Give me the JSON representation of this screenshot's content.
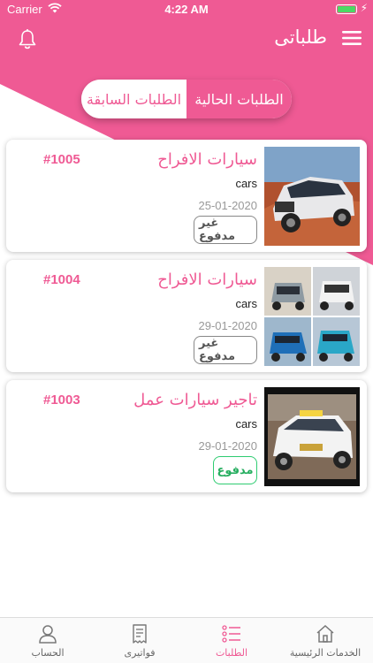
{
  "status_bar": {
    "carrier": "Carrier",
    "time": "4:22 AM"
  },
  "nav": {
    "title": "طلباتى"
  },
  "segment": {
    "past_label": "الطلبات السابقة",
    "current_label": "الطلبات الحالية",
    "selected": "current"
  },
  "orders": [
    {
      "name": "سيارات الافراح",
      "category": "cars",
      "date": "25-01-2020",
      "order_no": "#1005",
      "payment": "غير مدفوع",
      "paid": false
    },
    {
      "name": "سيارات الافراح",
      "category": "cars",
      "date": "29-01-2020",
      "order_no": "#1004",
      "payment": "غير مدفوع",
      "paid": false
    },
    {
      "name": "تاجير سيارات عمل",
      "category": "cars",
      "date": "29-01-2020",
      "order_no": "#1003",
      "payment": "مدفوع",
      "paid": true
    }
  ],
  "tabs": [
    {
      "label": "الخدمات الرئيسية",
      "icon": "home-icon"
    },
    {
      "label": "الطلبات",
      "icon": "list-icon"
    },
    {
      "label": "فواتيرى",
      "icon": "receipt-icon"
    },
    {
      "label": "الحساب",
      "icon": "user-icon"
    }
  ],
  "colors": {
    "brand": "#ef5a94",
    "paid": "#2ecc71"
  }
}
